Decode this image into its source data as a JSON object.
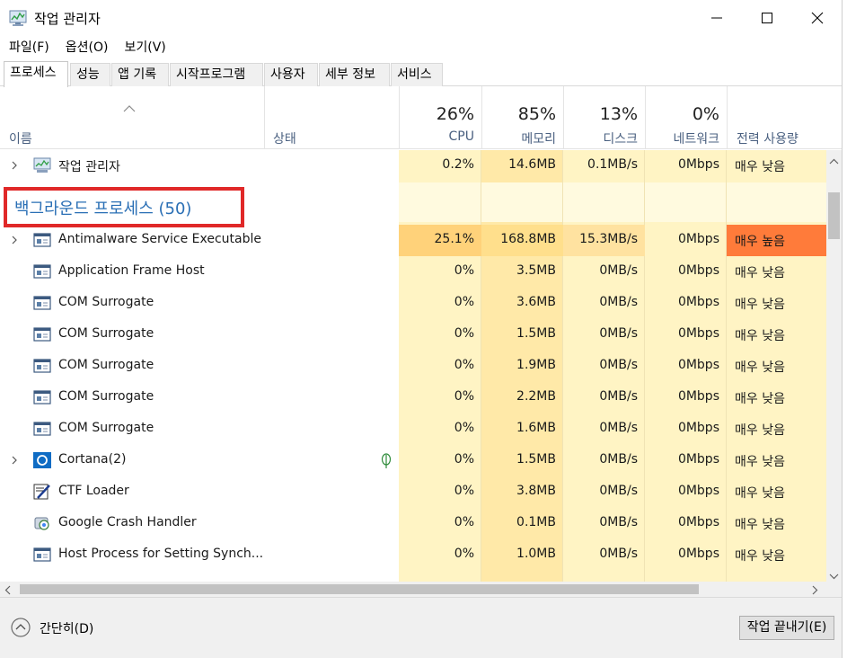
{
  "window": {
    "title": "작업 관리자",
    "icon": "task-manager-icon",
    "controls": [
      "minimize",
      "maximize",
      "close"
    ]
  },
  "menu": [
    "파일(F)",
    "옵션(O)",
    "보기(V)"
  ],
  "tabs": [
    {
      "label": "프로세스",
      "active": true
    },
    {
      "label": "성능",
      "active": false
    },
    {
      "label": "앱 기록",
      "active": false
    },
    {
      "label": "시작프로그램",
      "active": false
    },
    {
      "label": "사용자",
      "active": false
    },
    {
      "label": "세부 정보",
      "active": false
    },
    {
      "label": "서비스",
      "active": false
    }
  ],
  "columns": {
    "name": "이름",
    "status": "상태",
    "cpu": {
      "pct": "26%",
      "label": "CPU"
    },
    "memory": {
      "pct": "85%",
      "label": "메모리"
    },
    "disk": {
      "pct": "13%",
      "label": "디스크"
    },
    "network": {
      "pct": "0%",
      "label": "네트워크"
    },
    "power": {
      "label": "전력 사용량"
    }
  },
  "apps": [
    {
      "name": "작업 관리자",
      "icon": "task-manager-icon",
      "expandable": true,
      "cpu": "0.2%",
      "memory": "14.6MB",
      "disk": "0.1MB/s",
      "network": "0Mbps",
      "power": "매우 낮음",
      "highlight": false
    }
  ],
  "background_group": {
    "title": "백그라운드 프로세스 (50)"
  },
  "processes": [
    {
      "name": "Antimalware Service Executable",
      "icon": "service-window-icon",
      "expandable": true,
      "leaf": false,
      "cpu": "25.1%",
      "memory": "168.8MB",
      "disk": "15.3MB/s",
      "network": "0Mbps",
      "power": "매우 높음",
      "highlight": true
    },
    {
      "name": "Application Frame Host",
      "icon": "service-window-icon",
      "expandable": false,
      "leaf": false,
      "cpu": "0%",
      "memory": "3.5MB",
      "disk": "0MB/s",
      "network": "0Mbps",
      "power": "매우 낮음",
      "highlight": false
    },
    {
      "name": "COM Surrogate",
      "icon": "service-window-icon",
      "expandable": false,
      "leaf": false,
      "cpu": "0%",
      "memory": "3.6MB",
      "disk": "0MB/s",
      "network": "0Mbps",
      "power": "매우 낮음",
      "highlight": false
    },
    {
      "name": "COM Surrogate",
      "icon": "service-window-icon",
      "expandable": false,
      "leaf": false,
      "cpu": "0%",
      "memory": "1.5MB",
      "disk": "0MB/s",
      "network": "0Mbps",
      "power": "매우 낮음",
      "highlight": false
    },
    {
      "name": "COM Surrogate",
      "icon": "service-window-icon",
      "expandable": false,
      "leaf": false,
      "cpu": "0%",
      "memory": "1.9MB",
      "disk": "0MB/s",
      "network": "0Mbps",
      "power": "매우 낮음",
      "highlight": false
    },
    {
      "name": "COM Surrogate",
      "icon": "service-window-icon",
      "expandable": false,
      "leaf": false,
      "cpu": "0%",
      "memory": "2.2MB",
      "disk": "0MB/s",
      "network": "0Mbps",
      "power": "매우 낮음",
      "highlight": false
    },
    {
      "name": "COM Surrogate",
      "icon": "service-window-icon",
      "expandable": false,
      "leaf": false,
      "cpu": "0%",
      "memory": "1.6MB",
      "disk": "0MB/s",
      "network": "0Mbps",
      "power": "매우 낮음",
      "highlight": false
    },
    {
      "name": "Cortana(2)",
      "icon": "cortana-icon",
      "expandable": true,
      "leaf": true,
      "cpu": "0%",
      "memory": "1.5MB",
      "disk": "0MB/s",
      "network": "0Mbps",
      "power": "매우 낮음",
      "highlight": false
    },
    {
      "name": "CTF Loader",
      "icon": "ctf-loader-icon",
      "expandable": false,
      "leaf": false,
      "cpu": "0%",
      "memory": "3.8MB",
      "disk": "0MB/s",
      "network": "0Mbps",
      "power": "매우 낮음",
      "highlight": false
    },
    {
      "name": "Google Crash Handler",
      "icon": "google-crash-handler-icon",
      "expandable": false,
      "leaf": false,
      "cpu": "0%",
      "memory": "0.1MB",
      "disk": "0MB/s",
      "network": "0Mbps",
      "power": "매우 낮음",
      "highlight": false
    },
    {
      "name": "Host Process for Setting Synch...",
      "icon": "service-window-icon",
      "expandable": false,
      "leaf": false,
      "cpu": "0%",
      "memory": "1.0MB",
      "disk": "0MB/s",
      "network": "0Mbps",
      "power": "매우 낮음",
      "highlight": false
    }
  ],
  "footer": {
    "collapse_label": "간단히(D)",
    "end_task_label": "작업 끝내기(E)"
  },
  "colors": {
    "cpu_bg": "#fff4c4",
    "memory_bg": "#ffe9a8",
    "disk_bg": "#fff4c4",
    "network_bg": "#fff4c4",
    "power_bg": "#fff4c4",
    "cpu_high": "#ffd27a",
    "memory_high": "#ffdf8c",
    "disk_high": "#ffe2a0",
    "power_high": "#ff7b3a",
    "group_title": "#2a6fb5",
    "annotation_box": "#e02828"
  }
}
